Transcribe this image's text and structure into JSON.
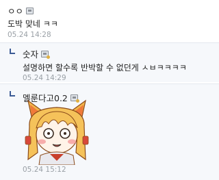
{
  "comments": [
    {
      "nickname": "ㅇㅇ",
      "body": "도박 맞네 ㅋㅋ",
      "date": "05.24 14:28"
    },
    {
      "nickname": "숫자",
      "body": "설명하면 할수록 반박할 수 없던게 ㅅㅂㅋㅋㅋㅋ",
      "date": "05.24 14:29"
    },
    {
      "nickname": "멜룬다고0.2",
      "date": "05.24 15:12"
    }
  ],
  "icons": {
    "user_badge": "user-badge-icon",
    "reply_marker": "reply-arrow-icon"
  },
  "colors": {
    "reply_background": "#f6f8fb",
    "date_text": "#9aa0a6",
    "reply_marker": "#3b5b95"
  }
}
